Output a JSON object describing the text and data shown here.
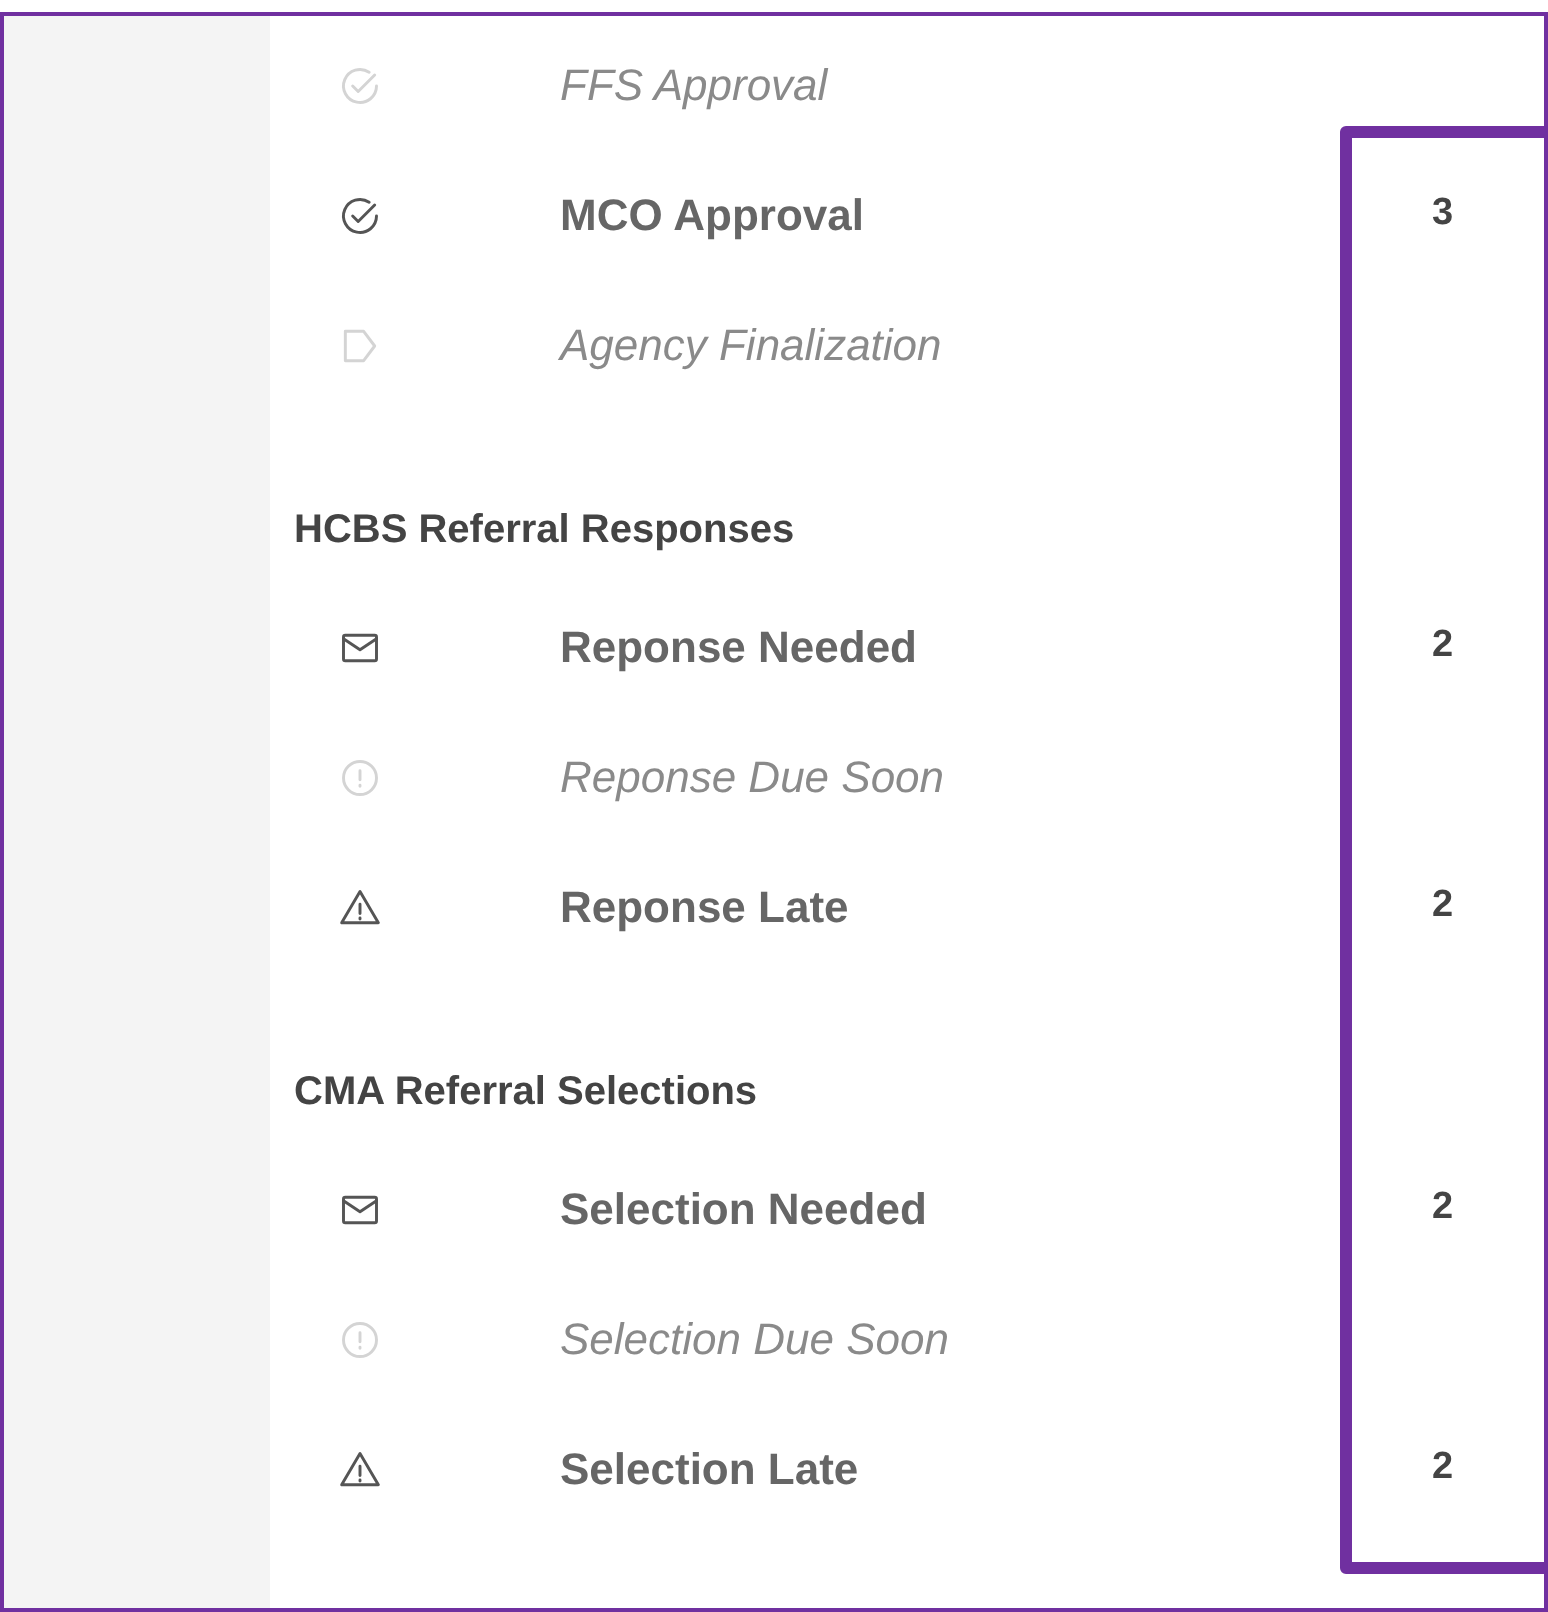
{
  "sections": [
    {
      "items": [
        {
          "kind": "check",
          "label": "FFS Approval",
          "disabled": true
        },
        {
          "kind": "check",
          "label": "MCO Approval",
          "disabled": false,
          "count": "3"
        },
        {
          "kind": "tag",
          "label": "Agency Finalization",
          "disabled": true
        }
      ]
    },
    {
      "heading": "HCBS Referral Responses",
      "items": [
        {
          "kind": "mail",
          "label": "Reponse Needed",
          "disabled": false,
          "count": "2"
        },
        {
          "kind": "alert",
          "label": "Reponse Due Soon",
          "disabled": true
        },
        {
          "kind": "warning",
          "label": "Reponse Late",
          "disabled": false,
          "count": "2"
        }
      ]
    },
    {
      "heading": "CMA Referral Selections",
      "items": [
        {
          "kind": "mail",
          "label": "Selection Needed",
          "disabled": false,
          "count": "2"
        },
        {
          "kind": "alert",
          "label": "Selection Due Soon",
          "disabled": true
        },
        {
          "kind": "warning",
          "label": "Selection Late",
          "disabled": false,
          "count": "2"
        }
      ]
    }
  ]
}
